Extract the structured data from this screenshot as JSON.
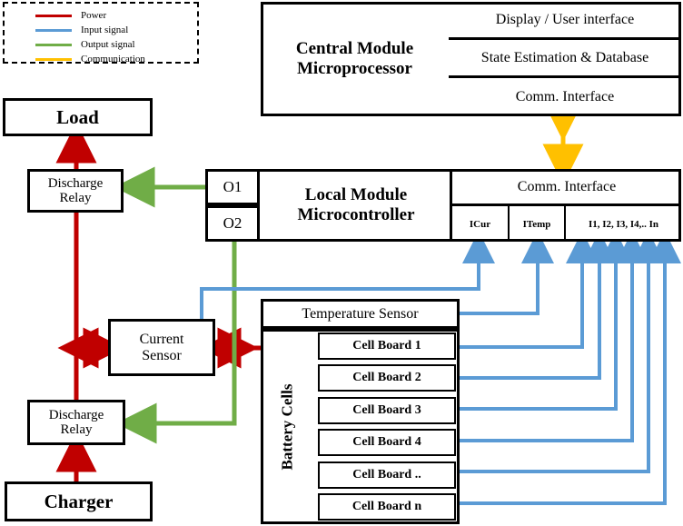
{
  "legend": {
    "title": "signal legend",
    "items": [
      {
        "label": "Power",
        "color": "#C00000",
        "icon": "line-swatch-icon"
      },
      {
        "label": "Input signal",
        "color": "#5B9BD5",
        "icon": "line-swatch-icon"
      },
      {
        "label": "Output signal",
        "color": "#70AD47",
        "icon": "line-swatch-icon"
      },
      {
        "label": "Communication",
        "color": "#FFC000",
        "icon": "line-swatch-icon"
      }
    ]
  },
  "central_module": {
    "title": "Central Module\nMicroprocessor",
    "title_line1": "Central Module",
    "title_line2": "Microprocessor",
    "rows": [
      "Display / User interface",
      "State Estimation & Database",
      "Comm. Interface"
    ]
  },
  "local_module": {
    "title_line1": "Local Module",
    "title_line2": "Microcontroller",
    "outputs": [
      "O1",
      "O2"
    ],
    "comm_label": "Comm. Interface",
    "inputs": [
      "ICur",
      "ITemp",
      "I1, I2, I3, I4,.. In"
    ]
  },
  "left_blocks": {
    "load": "Load",
    "discharge_relay_top_line1": "Discharge",
    "discharge_relay_top_line2": "Relay",
    "current_sensor_line1": "Current",
    "current_sensor_line2": "Sensor",
    "discharge_relay_bottom_line1": "Discharge",
    "discharge_relay_bottom_line2": "Relay",
    "charger": "Charger"
  },
  "battery": {
    "temperature_sensor": "Temperature  Sensor",
    "group_label": "Battery Cells",
    "cell_boards": [
      "Cell Board 1",
      "Cell Board 2",
      "Cell Board 3",
      "Cell Board 4",
      "Cell Board ..",
      "Cell Board n"
    ]
  },
  "colors": {
    "power": "#C00000",
    "input_signal": "#5B9BD5",
    "output_signal": "#70AD47",
    "communication": "#FFC000",
    "outline": "#000000",
    "background": "#FFFFFF"
  }
}
